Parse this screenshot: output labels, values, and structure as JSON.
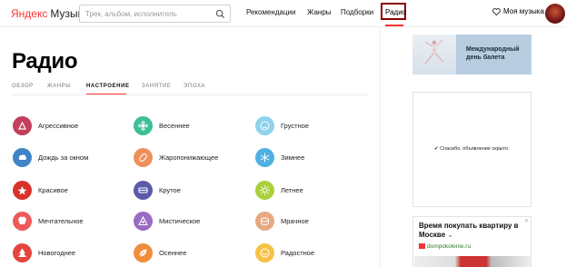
{
  "header": {
    "logo_brand": "Яндекс",
    "logo_product": "Музыка",
    "search_placeholder": "Трек, альбом, исполнитель",
    "nav": [
      "Рекомендации",
      "Жанры",
      "Подборки",
      "Радио"
    ],
    "my_music": "Моя музыка"
  },
  "page": {
    "title": "Радио",
    "tabs": [
      "ОБЗОР",
      "ЖАНРЫ",
      "НАСТРОЕНИЕ",
      "ЗАНЯТИЕ",
      "ЭПОХА"
    ],
    "active_tab": "НАСТРОЕНИЕ"
  },
  "moods": [
    {
      "label": "Агрессивное",
      "color": "#c2405c",
      "icon": "aggressive-icon"
    },
    {
      "label": "Весеннее",
      "color": "#3dbf98",
      "icon": "spring-icon"
    },
    {
      "label": "Грустное",
      "color": "#8ed3eb",
      "icon": "sad-icon"
    },
    {
      "label": "Дождь за окном",
      "color": "#3f85c6",
      "icon": "rain-icon"
    },
    {
      "label": "Жаропонижающее",
      "color": "#ef8f5a",
      "icon": "heat-icon"
    },
    {
      "label": "Зимнее",
      "color": "#4fb0e3",
      "icon": "snowflake-icon"
    },
    {
      "label": "Красивое",
      "color": "#d9322b",
      "icon": "beautiful-icon"
    },
    {
      "label": "Крутое",
      "color": "#5a5ba8",
      "icon": "cool-icon"
    },
    {
      "label": "Летнее",
      "color": "#a9cf3a",
      "icon": "sun-icon"
    },
    {
      "label": "Мечтательное",
      "color": "#ee5a5a",
      "icon": "dreamy-icon"
    },
    {
      "label": "Мистическое",
      "color": "#9b6ac3",
      "icon": "mystic-icon"
    },
    {
      "label": "Мрачное",
      "color": "#e6a982",
      "icon": "gloomy-icon"
    },
    {
      "label": "Новогоднее",
      "color": "#e5453e",
      "icon": "new-year-icon"
    },
    {
      "label": "Осеннее",
      "color": "#ef8e3b",
      "icon": "autumn-leaf-icon"
    },
    {
      "label": "Радостное",
      "color": "#f5c244",
      "icon": "joyful-icon"
    }
  ],
  "sidebar": {
    "promo_text": "Международный день балета",
    "hidden_ad_message": "Спасибо, объявление скрыто.",
    "ad_title": "Время покупать квартиру в Москве",
    "ad_domain": "dompokolenie.ru"
  },
  "colors": {
    "accent": "#ff3333",
    "active_border": "#8b0000"
  }
}
